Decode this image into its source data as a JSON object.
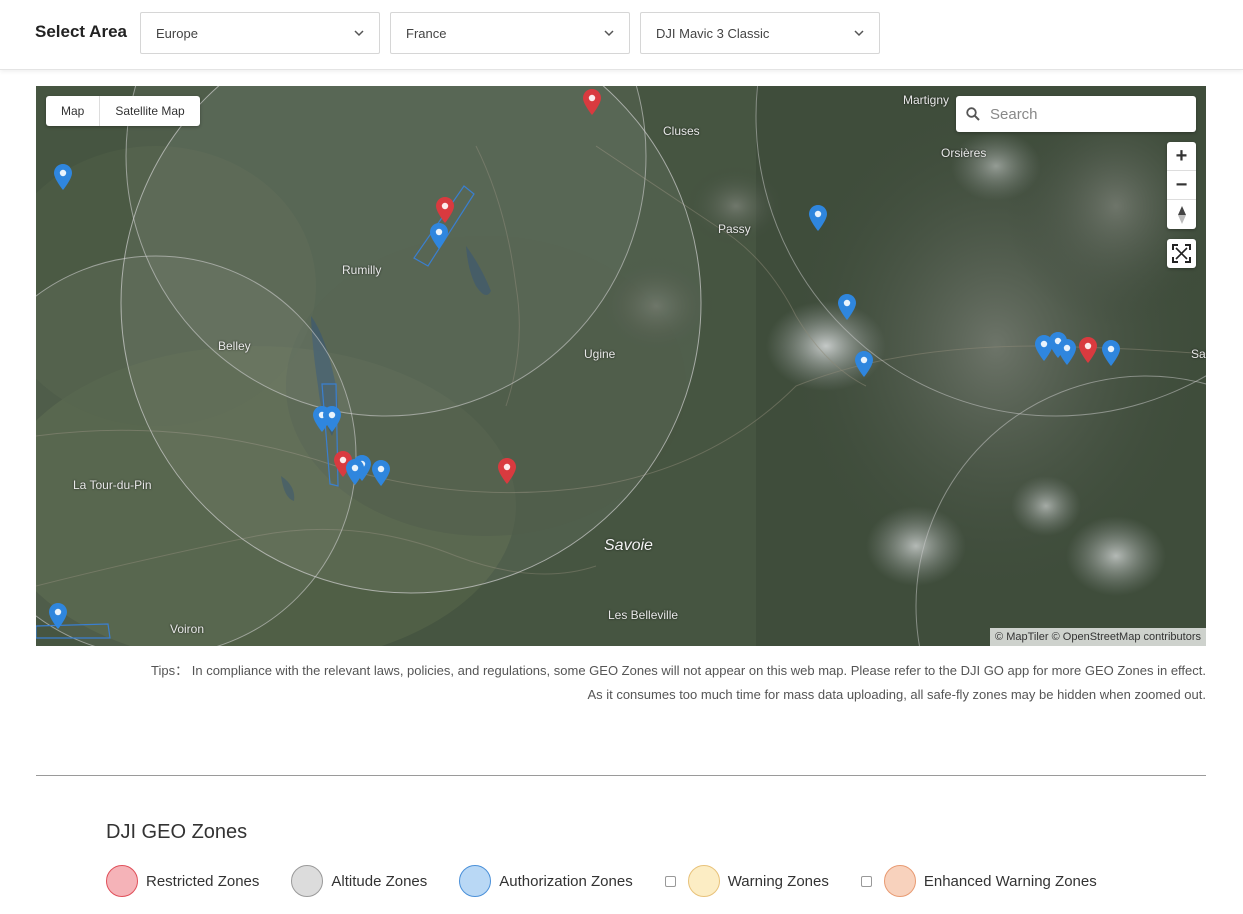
{
  "header": {
    "title": "Select Area",
    "region": "Europe",
    "country": "France",
    "aircraft": "DJI Mavic 3 Classic"
  },
  "map": {
    "type_buttons": [
      "Map",
      "Satellite Map"
    ],
    "search_placeholder": "Search",
    "zoom_in": "+",
    "zoom_out": "−",
    "attribution": "© MapTiler © OpenStreetMap contributors",
    "places": {
      "martigny": "Martigny",
      "cluses": "Cluses",
      "orsieres": "Orsières",
      "passy": "Passy",
      "rumilly": "Rumilly",
      "belley": "Belley",
      "ugine": "Ugine",
      "saint": "Saint",
      "la_tour_du_pin": "La Tour-du-Pin",
      "savoie": "Savoie",
      "voiron": "Voiron",
      "les_belleville": "Les Belleville"
    }
  },
  "tips": {
    "line1": "Tips： In compliance with the relevant laws, policies, and regulations, some GEO Zones will not appear on this web map. Please refer to the DJI GO app for more GEO Zones in effect.",
    "line2": "As it consumes too much time for mass data uploading, all safe-fly zones may be hidden when zoomed out."
  },
  "zones": {
    "title": "DJI GEO Zones",
    "legend": [
      {
        "label": "Restricted Zones",
        "fill": "#f5b3b8",
        "stroke": "#e0505a",
        "checkbox": false
      },
      {
        "label": "Altitude Zones",
        "fill": "#dcdcdc",
        "stroke": "#9a9a9a",
        "checkbox": false
      },
      {
        "label": "Authorization Zones",
        "fill": "#b9d8f5",
        "stroke": "#4a90d9",
        "checkbox": false
      },
      {
        "label": "Warning Zones",
        "fill": "#fcedc4",
        "stroke": "#e8c27a",
        "checkbox": true
      },
      {
        "label": "Enhanced Warning Zones",
        "fill": "#f8d2bd",
        "stroke": "#e89a72",
        "checkbox": true
      }
    ]
  },
  "colors": {
    "restricted_pin": "#d93a3f",
    "authorization_pin": "#2f86de"
  },
  "icons": [
    "chevron-down-icon",
    "search-icon",
    "zoom-in-icon",
    "zoom-out-icon",
    "compass-icon",
    "fullscreen-icon",
    "map-pin-icon"
  ]
}
